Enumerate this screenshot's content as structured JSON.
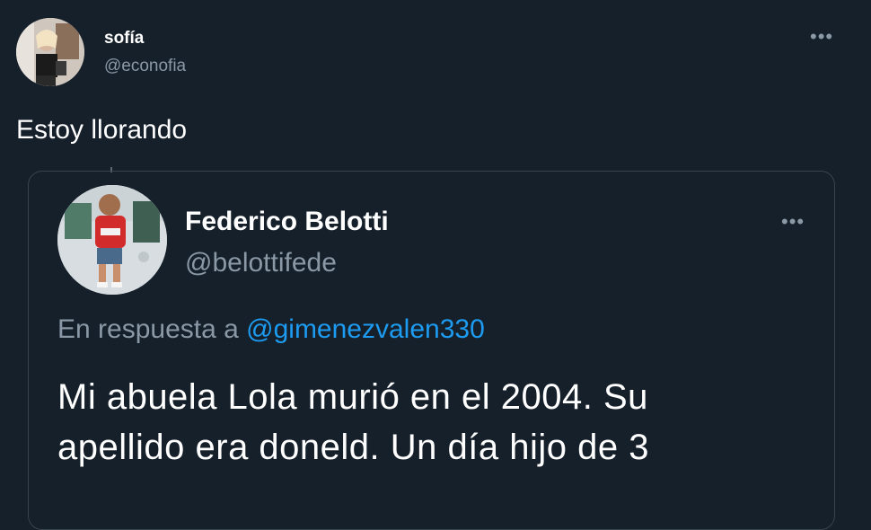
{
  "tweet": {
    "author_name": "sofía",
    "author_handle": "@econofia",
    "text": "Estoy llorando",
    "more_icon": "ellipsis-icon"
  },
  "quoted": {
    "author_name": "Federico Belotti",
    "author_handle": "@belottifede",
    "reply_prefix": "En respuesta a",
    "reply_mention": "@gimenezvalen330",
    "text_line1": "Mi abuela Lola murió en el 2004. Su",
    "text_line2": "apellido era doneld. Un día hijo de 3",
    "more_icon": "ellipsis-icon"
  },
  "colors": {
    "background": "#15202b",
    "secondary_text": "#8b98a5",
    "link": "#1d9bf0",
    "border": "#38444d"
  }
}
